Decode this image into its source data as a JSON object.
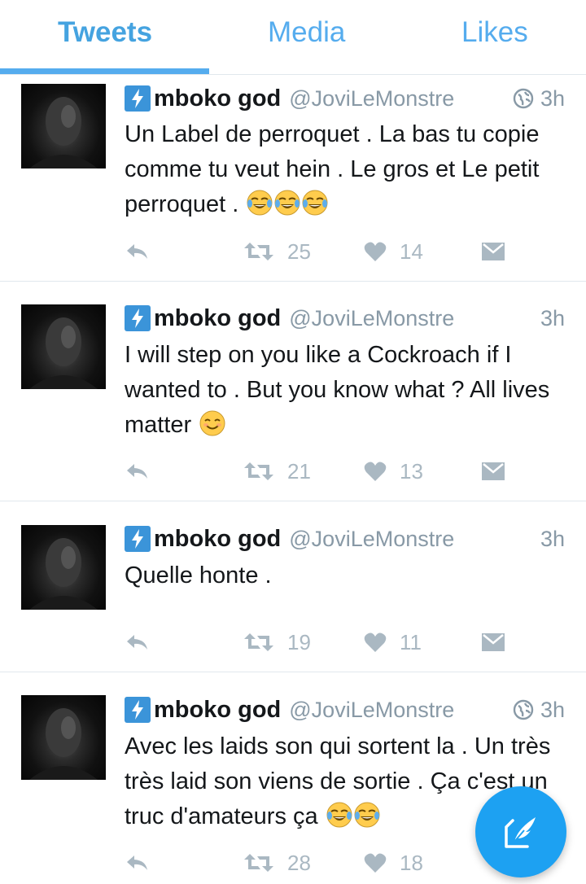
{
  "tabs": [
    {
      "label": "Tweets",
      "active": true
    },
    {
      "label": "Media",
      "active": false
    },
    {
      "label": "Likes",
      "active": false
    }
  ],
  "tweets": [
    {
      "name": "mboko god",
      "handle": "@JoviLeMonstre",
      "time": "3h",
      "has_globe": true,
      "text": "Un Label de perroquet . La bas tu copie comme tu veut hein . Le gros et Le petit perroquet .",
      "emoji": [
        "face-with-tears-of-joy",
        "face-with-tears-of-joy",
        "face-with-tears-of-joy"
      ],
      "retweets": "25",
      "likes": "14"
    },
    {
      "name": "mboko god",
      "handle": "@JoviLeMonstre",
      "time": "3h",
      "has_globe": false,
      "text": "I will step on you like a Cockroach if I wanted to . But you know what ? All lives matter",
      "emoji": [
        "smiling-face"
      ],
      "retweets": "21",
      "likes": "13"
    },
    {
      "name": "mboko god",
      "handle": "@JoviLeMonstre",
      "time": "3h",
      "has_globe": false,
      "text": "Quelle honte .",
      "emoji": [],
      "retweets": "19",
      "likes": "11"
    },
    {
      "name": "mboko god",
      "handle": "@JoviLeMonstre",
      "time": "3h",
      "has_globe": true,
      "text": "Avec les laids son qui sortent la . Un très très laid son viens de sortie . Ça c'est un truc d'amateurs ça",
      "emoji": [
        "face-with-tears-of-joy",
        "face-with-tears-of-joy"
      ],
      "retweets": "28",
      "likes": "18"
    }
  ],
  "icons": {
    "badge": "lightning-badge-icon",
    "globe": "globe-icon",
    "reply": "reply-icon",
    "retweet": "retweet-icon",
    "like": "heart-icon",
    "dm": "direct-message-icon",
    "compose": "compose-tweet-icon"
  },
  "colors": {
    "accent": "#55acee",
    "fab": "#1da1f2",
    "muted": "#8899a6",
    "action": "#aab8c2"
  }
}
